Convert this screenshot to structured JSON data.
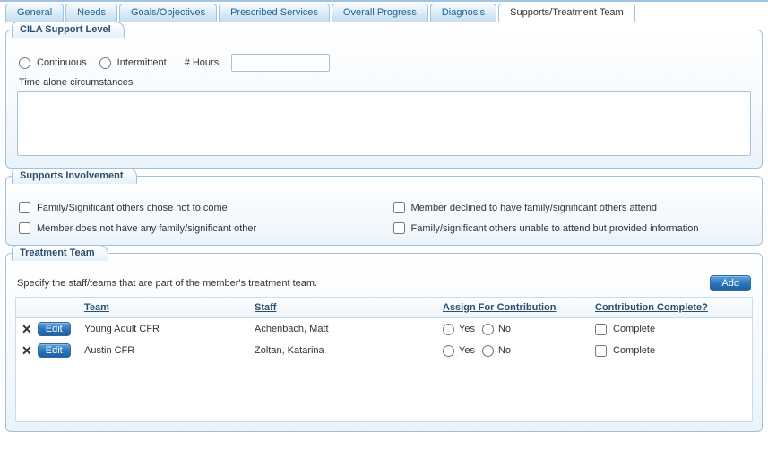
{
  "tabs": {
    "general": "General",
    "needs": "Needs",
    "goals": "Goals/Objectives",
    "services": "Prescribed Services",
    "progress": "Overall Progress",
    "diagnosis": "Diagnosis",
    "supports": "Supports/Treatment Team"
  },
  "cila": {
    "legend": "CILA Support Level",
    "continuous": "Continuous",
    "intermittent": "Intermittent",
    "hours_label": "# Hours",
    "hours_value": "",
    "tac_label": "Time alone circumstances",
    "tac_value": ""
  },
  "involvement": {
    "legend": "Supports Involvement",
    "opt1": "Family/Significant others chose not to come",
    "opt2": "Member declined to have family/significant others attend",
    "opt3": "Member does not have any family/significant other",
    "opt4": "Family/significant others unable to attend but provided information"
  },
  "team": {
    "legend": "Treatment Team",
    "instr": "Specify the staff/teams that are part of the member's treatment team.",
    "add_label": "Add",
    "edit_label": "Edit",
    "headers": {
      "team": "Team",
      "staff": "Staff",
      "assign": "Assign For Contribution",
      "complete": "Contribution Complete?"
    },
    "yes": "Yes",
    "no": "No",
    "complete": "Complete",
    "rows": [
      {
        "team": "Young Adult CFR",
        "staff": "Achenbach, Matt"
      },
      {
        "team": "Austin CFR",
        "staff": "Zoltan, Katarina"
      }
    ]
  }
}
